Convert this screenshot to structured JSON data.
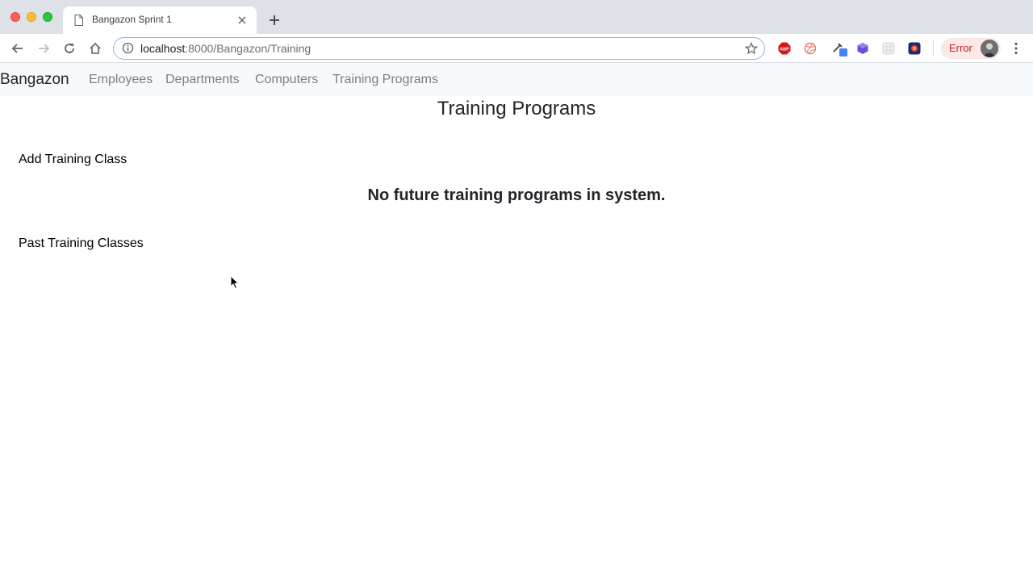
{
  "browser": {
    "tab": {
      "title": "Bangazon Sprint 1"
    },
    "address_bar": {
      "host": "localhost",
      "path": ":8000/Bangazon/Training"
    },
    "error_chip": {
      "label": "Error"
    },
    "extensions": [
      {
        "name": "adblock-icon",
        "color": "#d9141b"
      },
      {
        "name": "dribbble-like-icon",
        "color": "#e07a6b"
      },
      {
        "name": "eyedropper-icon",
        "color": "#4285f4"
      },
      {
        "name": "cube-icon",
        "color": "#6e4bd8"
      },
      {
        "name": "grid-icon",
        "color": "#d5d8dc"
      },
      {
        "name": "swirl-icon",
        "color": "#1a2a6c"
      }
    ]
  },
  "navbar": {
    "brand": "Bangazon",
    "links": [
      {
        "label": "Employees"
      },
      {
        "label": "Departments"
      },
      {
        "label": "Computers"
      },
      {
        "label": "Training Programs"
      }
    ]
  },
  "main": {
    "title": "Training Programs",
    "add_link": "Add Training Class",
    "empty_message": "No future training programs in system.",
    "past_link": "Past Training Classes"
  },
  "colors": {
    "tabstrip": "#dee1e6",
    "omnibox_focus": "#8ab4f8",
    "navbar_bg": "#f8f9fa",
    "nav_link": "#7b7f83",
    "error_bg": "#fce8e6",
    "error_text": "#c5221f"
  }
}
